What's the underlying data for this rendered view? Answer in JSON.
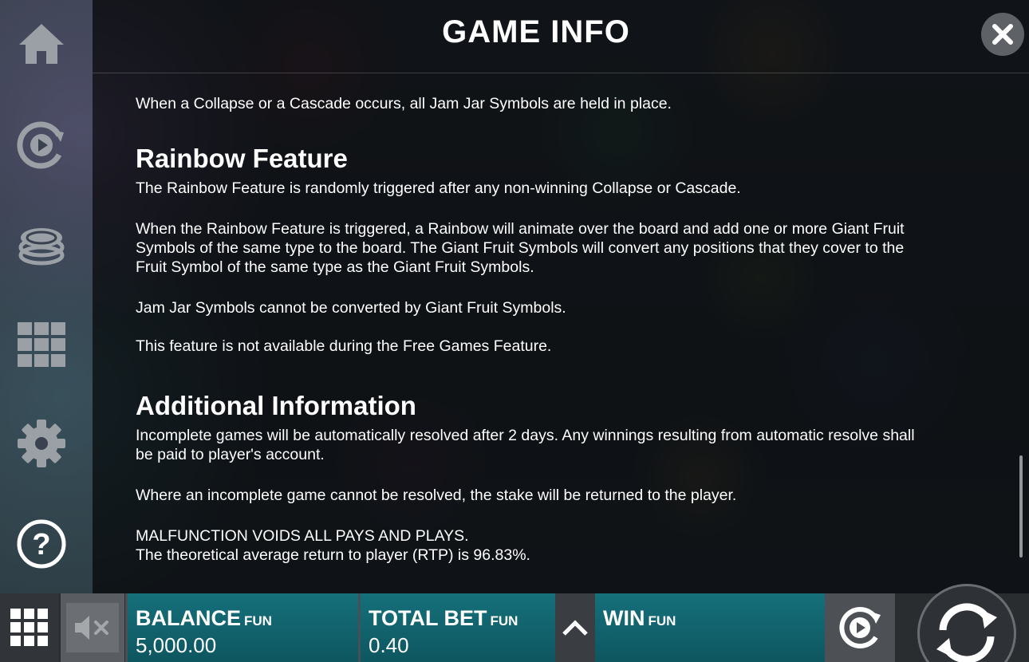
{
  "header": {
    "title": "GAME INFO"
  },
  "sidebar": {
    "items": [
      {
        "icon": "home-icon"
      },
      {
        "icon": "autoplay-icon"
      },
      {
        "icon": "coins-icon"
      },
      {
        "icon": "grid-icon"
      },
      {
        "icon": "gear-icon"
      },
      {
        "icon": "help-icon"
      }
    ]
  },
  "content": {
    "p_jam_jar_held": "When a Collapse or a Cascade occurs, all Jam Jar Symbols are held in place.",
    "rainbow_heading": "Rainbow Feature",
    "rainbow_p1": "The Rainbow Feature is randomly triggered after any non-winning Collapse or Cascade.",
    "rainbow_p2": "When the Rainbow Feature is triggered, a Rainbow will animate over the board and add one or more Giant Fruit Symbols of the same type to the board. The Giant Fruit Symbols will convert any positions that they cover to the Fruit Symbol of the same type as the Giant Fruit Symbols.",
    "rainbow_p3": "Jam Jar Symbols cannot be converted by Giant Fruit Symbols.",
    "rainbow_p4": "This feature is not available during the Free Games Feature.",
    "additional_heading": "Additional Information",
    "additional_p1": "Incomplete games will be automatically resolved after 2 days. Any winnings resulting from automatic resolve shall be paid to player's account.",
    "additional_p2": "Where an incomplete game cannot be resolved, the stake will be returned to the player.",
    "additional_p3a": "MALFUNCTION VOIDS ALL PAYS AND PLAYS.",
    "additional_p3b": "The theoretical average return to player (RTP) is 96.83%."
  },
  "bottom": {
    "balance_label": "BALANCE",
    "balance_currency": "FUN",
    "balance_value": "5,000.00",
    "bet_label": "TOTAL BET",
    "bet_currency": "FUN",
    "bet_value": "0.40",
    "win_label": "WIN",
    "win_currency": "FUN"
  },
  "colors": {
    "accent_teal": "#15707a",
    "panel_bg": "#0a0c0f",
    "icon_gray": "#9aa0a6"
  }
}
